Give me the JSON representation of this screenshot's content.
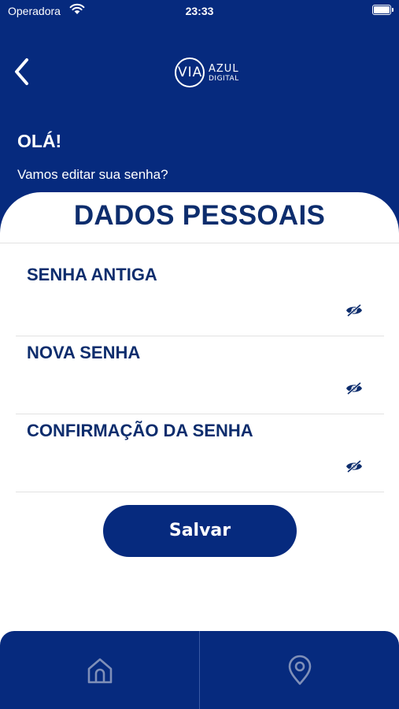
{
  "status_bar": {
    "carrier": "Operadora",
    "time": "23:33"
  },
  "header": {
    "logo": {
      "via": "VIA",
      "azul": "AZUL",
      "digital": "DIGITAL"
    },
    "greeting": "OLÁ!",
    "subtitle": "Vamos editar sua senha?"
  },
  "card": {
    "title": "DADOS PESSOAIS",
    "fields": [
      {
        "label": "SENHA ANTIGA",
        "value": "",
        "icon": "eye-slash-icon"
      },
      {
        "label": "NOVA SENHA",
        "value": "",
        "icon": "eye-slash-icon"
      },
      {
        "label": "CONFIRMAÇÃO DA SENHA",
        "value": "",
        "icon": "eye-slash-icon"
      }
    ],
    "save_label": "Salvar"
  },
  "bottom_nav": {
    "items": [
      {
        "icon": "home-icon"
      },
      {
        "icon": "location-pin-icon"
      }
    ]
  },
  "colors": {
    "primary": "#062a7e",
    "text": "#0d2d6d",
    "background": "#ffffff",
    "divider": "#e2e2e2"
  }
}
